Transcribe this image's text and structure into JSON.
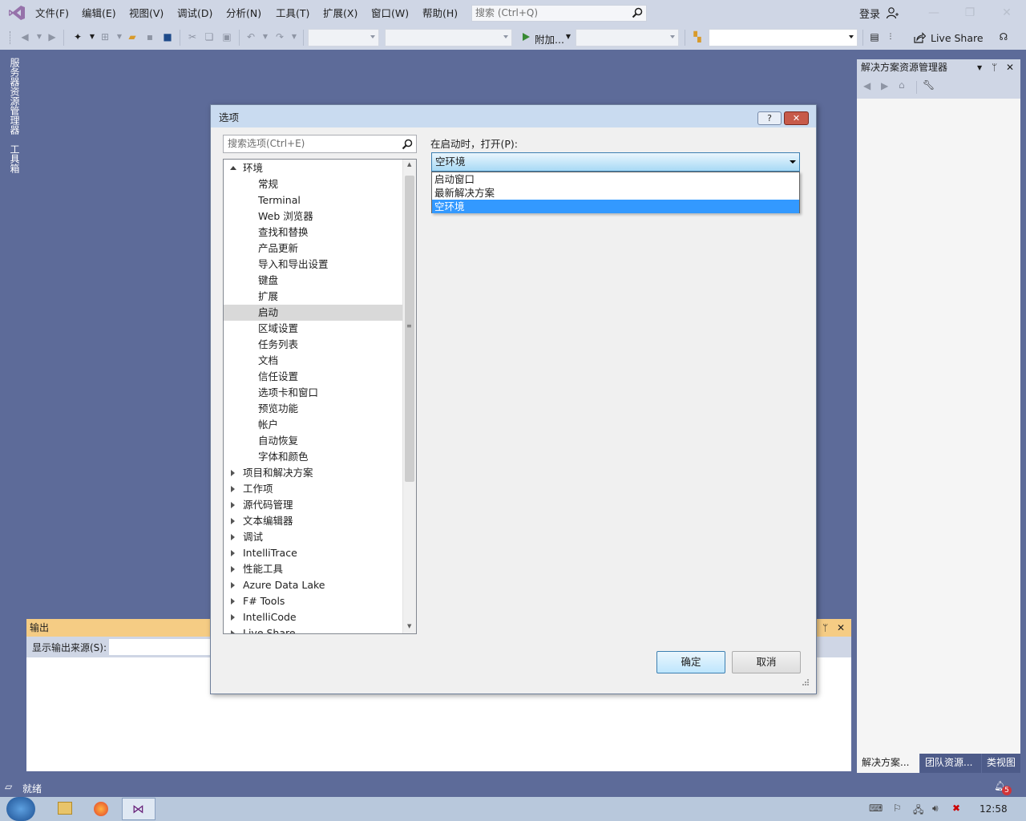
{
  "colors": {
    "accent": "#3399ff",
    "ide_background": "#5d6b99",
    "chrome": "#cfd6e5",
    "output_tab": "#f5cc84"
  },
  "menubar": {
    "items": [
      "文件(F)",
      "编辑(E)",
      "视图(V)",
      "调试(D)",
      "分析(N)",
      "工具(T)",
      "扩展(X)",
      "窗口(W)",
      "帮助(H)"
    ]
  },
  "search": {
    "placeholder": "搜索 (Ctrl+Q)"
  },
  "account": {
    "signin": "登录"
  },
  "toolbar": {
    "attach_label": "附加...",
    "live_share": "Live Share"
  },
  "side_tabs": {
    "server_explorer": "服务器资源管理器",
    "toolbox": "工具箱"
  },
  "solution_explorer": {
    "title": "解决方案资源管理器",
    "tabs": [
      "解决方案...",
      "团队资源...",
      "类视图"
    ]
  },
  "output": {
    "title": "输出",
    "source_label": "显示输出来源(S):"
  },
  "status": {
    "text": "就绪",
    "notifications": "5"
  },
  "taskbar": {
    "time": "12:58"
  },
  "dialog": {
    "title": "选项",
    "help": "?",
    "search_placeholder": "搜索选项(Ctrl+E)",
    "tree": [
      {
        "label": "环境",
        "level": 0,
        "expanded": true
      },
      {
        "label": "常规",
        "level": 1
      },
      {
        "label": "Terminal",
        "level": 1
      },
      {
        "label": "Web 浏览器",
        "level": 1
      },
      {
        "label": "查找和替换",
        "level": 1
      },
      {
        "label": "产品更新",
        "level": 1
      },
      {
        "label": "导入和导出设置",
        "level": 1
      },
      {
        "label": "键盘",
        "level": 1
      },
      {
        "label": "扩展",
        "level": 1
      },
      {
        "label": "启动",
        "level": 1,
        "selected": true
      },
      {
        "label": "区域设置",
        "level": 1
      },
      {
        "label": "任务列表",
        "level": 1
      },
      {
        "label": "文档",
        "level": 1
      },
      {
        "label": "信任设置",
        "level": 1
      },
      {
        "label": "选项卡和窗口",
        "level": 1
      },
      {
        "label": "预览功能",
        "level": 1
      },
      {
        "label": "帐户",
        "level": 1
      },
      {
        "label": "自动恢复",
        "level": 1
      },
      {
        "label": "字体和颜色",
        "level": 1
      },
      {
        "label": "项目和解决方案",
        "level": 0,
        "expanded": false
      },
      {
        "label": "工作项",
        "level": 0,
        "expanded": false
      },
      {
        "label": "源代码管理",
        "level": 0,
        "expanded": false
      },
      {
        "label": "文本编辑器",
        "level": 0,
        "expanded": false
      },
      {
        "label": "调试",
        "level": 0,
        "expanded": false
      },
      {
        "label": "IntelliTrace",
        "level": 0,
        "expanded": false
      },
      {
        "label": "性能工具",
        "level": 0,
        "expanded": false
      },
      {
        "label": "Azure Data Lake",
        "level": 0,
        "expanded": false
      },
      {
        "label": "F# Tools",
        "level": 0,
        "expanded": false
      },
      {
        "label": "IntelliCode",
        "level": 0,
        "expanded": false
      },
      {
        "label": "Live Share",
        "level": 0,
        "expanded": false
      }
    ],
    "startup_label": "在启动时，打开(P):",
    "startup_value": "空环境",
    "startup_options": [
      "启动窗口",
      "最新解决方案",
      "空环境"
    ],
    "startup_selected_index": 2,
    "ok": "确定",
    "cancel": "取消"
  }
}
